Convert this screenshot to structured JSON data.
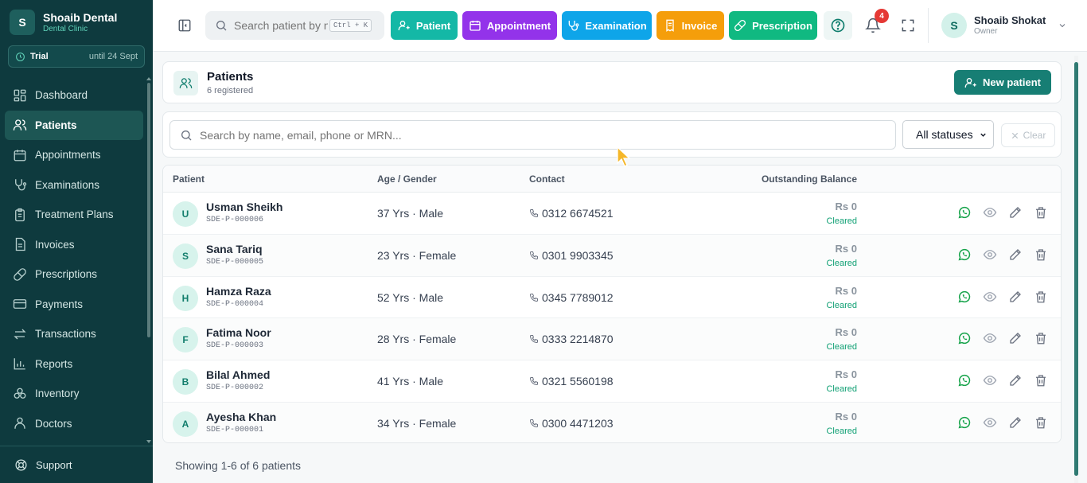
{
  "brand": {
    "logo_letter": "S",
    "name": "Shoaib Dental",
    "subtitle": "Dental Clinic"
  },
  "trial": {
    "label": "Trial",
    "until": "until 24 Sept"
  },
  "sidebar": {
    "items": [
      {
        "label": "Dashboard",
        "icon": "grid-icon",
        "active": false
      },
      {
        "label": "Patients",
        "icon": "users-icon",
        "active": true
      },
      {
        "label": "Appointments",
        "icon": "calendar-icon",
        "active": false
      },
      {
        "label": "Examinations",
        "icon": "stethoscope-icon",
        "active": false
      },
      {
        "label": "Treatment Plans",
        "icon": "clipboard-icon",
        "active": false
      },
      {
        "label": "Invoices",
        "icon": "file-icon",
        "active": false
      },
      {
        "label": "Prescriptions",
        "icon": "pill-icon",
        "active": false
      },
      {
        "label": "Payments",
        "icon": "credit-card-icon",
        "active": false
      },
      {
        "label": "Transactions",
        "icon": "arrows-icon",
        "active": false
      },
      {
        "label": "Reports",
        "icon": "bar-chart-icon",
        "active": false
      },
      {
        "label": "Inventory",
        "icon": "boxes-icon",
        "active": false
      },
      {
        "label": "Doctors",
        "icon": "doctor-icon",
        "active": false
      }
    ],
    "support_label": "Support"
  },
  "topbar": {
    "search_placeholder": "Search patient by name",
    "search_shortcut": "Ctrl + K",
    "quick_actions": [
      {
        "label": "Patient",
        "color": "#14b8a6"
      },
      {
        "label": "Appointment",
        "color": "#9333ea"
      },
      {
        "label": "Examination",
        "color": "#0ea5e9"
      },
      {
        "label": "Invoice",
        "color": "#f59e0b"
      },
      {
        "label": "Prescription",
        "color": "#10b981"
      }
    ],
    "notification_count": "4",
    "user": {
      "initial": "S",
      "name": "Shoaib Shokat",
      "role": "Owner"
    }
  },
  "page": {
    "title": "Patients",
    "subtitle": "6 registered",
    "new_button": "New patient"
  },
  "filters": {
    "search_placeholder": "Search by name, email, phone or MRN...",
    "status_selected": "All statuses",
    "clear_label": "Clear"
  },
  "table": {
    "columns": [
      "Patient",
      "Age / Gender",
      "Contact",
      "Outstanding Balance"
    ],
    "rows": [
      {
        "initial": "U",
        "name": "Usman Sheikh",
        "mrn": "SDE-P-000006",
        "age_gender": "37 Yrs · Male",
        "phone": "0312 6674521",
        "balance": "Rs 0",
        "status": "Cleared"
      },
      {
        "initial": "S",
        "name": "Sana Tariq",
        "mrn": "SDE-P-000005",
        "age_gender": "23 Yrs · Female",
        "phone": "0301 9903345",
        "balance": "Rs 0",
        "status": "Cleared"
      },
      {
        "initial": "H",
        "name": "Hamza Raza",
        "mrn": "SDE-P-000004",
        "age_gender": "52 Yrs · Male",
        "phone": "0345 7789012",
        "balance": "Rs 0",
        "status": "Cleared"
      },
      {
        "initial": "F",
        "name": "Fatima Noor",
        "mrn": "SDE-P-000003",
        "age_gender": "28 Yrs · Female",
        "phone": "0333 2214870",
        "balance": "Rs 0",
        "status": "Cleared"
      },
      {
        "initial": "B",
        "name": "Bilal Ahmed",
        "mrn": "SDE-P-000002",
        "age_gender": "41 Yrs · Male",
        "phone": "0321 5560198",
        "balance": "Rs 0",
        "status": "Cleared"
      },
      {
        "initial": "A",
        "name": "Ayesha Khan",
        "mrn": "SDE-P-000001",
        "age_gender": "34 Yrs · Female",
        "phone": "0300 4471203",
        "balance": "Rs 0",
        "status": "Cleared"
      }
    ]
  },
  "footer": {
    "showing": "Showing 1-6 of 6 patients"
  }
}
